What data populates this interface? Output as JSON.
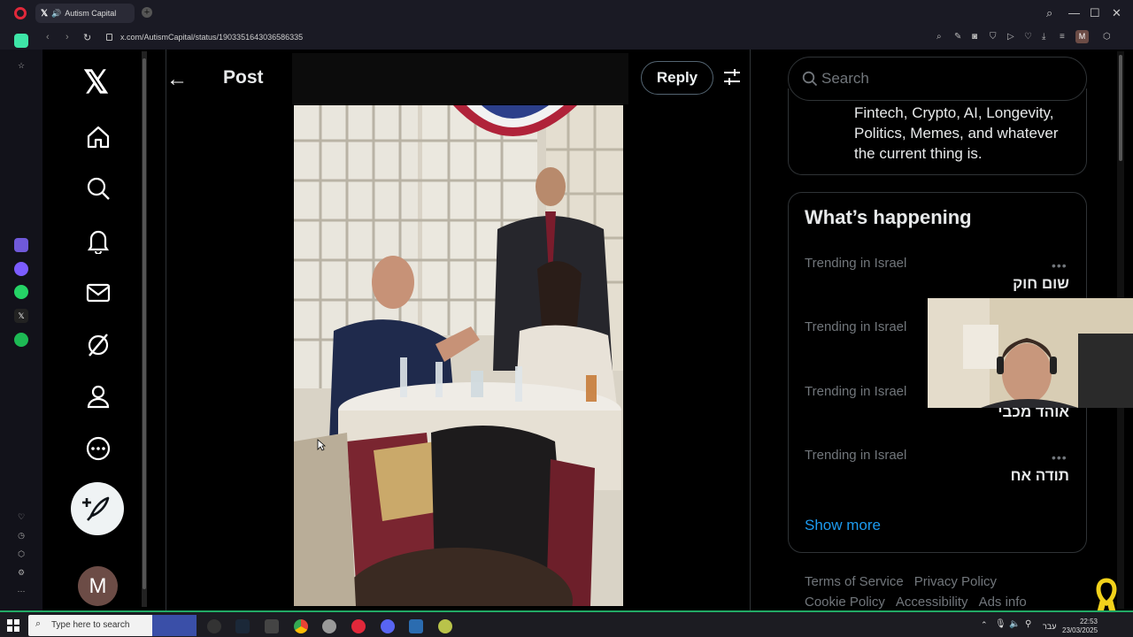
{
  "browser": {
    "tab_title": "Autism Capital",
    "url": "x.com/AutismCapital/status/1903351643036586335",
    "profile_initial": "M"
  },
  "x_nav": {
    "avatar_initial": "M"
  },
  "post_header": {
    "title": "Post",
    "reply_label": "Reply"
  },
  "search": {
    "placeholder": "Search"
  },
  "bio": {
    "text": "Fintech, Crypto, AI, Longevity, Politics, Memes, and whatever the current thing is."
  },
  "trends": {
    "title": "What’s happening",
    "items": [
      {
        "meta": "Trending in Israel",
        "name": "שום חוק"
      },
      {
        "meta": "Trending in Israel",
        "name": ""
      },
      {
        "meta": "Trending in Israel",
        "name": "אוהד מכבי"
      },
      {
        "meta": "Trending in Israel",
        "name": "תודה אח"
      }
    ],
    "show_more": "Show more"
  },
  "footer": {
    "terms": "Terms of Service",
    "privacy": "Privacy Policy",
    "cookie": "Cookie Policy",
    "accessibility": "Accessibility",
    "ads": "Ads info"
  },
  "taskbar": {
    "search_placeholder": "Type here to search",
    "lang": "עבר",
    "time": "22:53",
    "date": "23/03/2025"
  },
  "colors": {
    "accent": "#1d9bf0",
    "muted": "#71767b",
    "border": "#2f3336"
  }
}
